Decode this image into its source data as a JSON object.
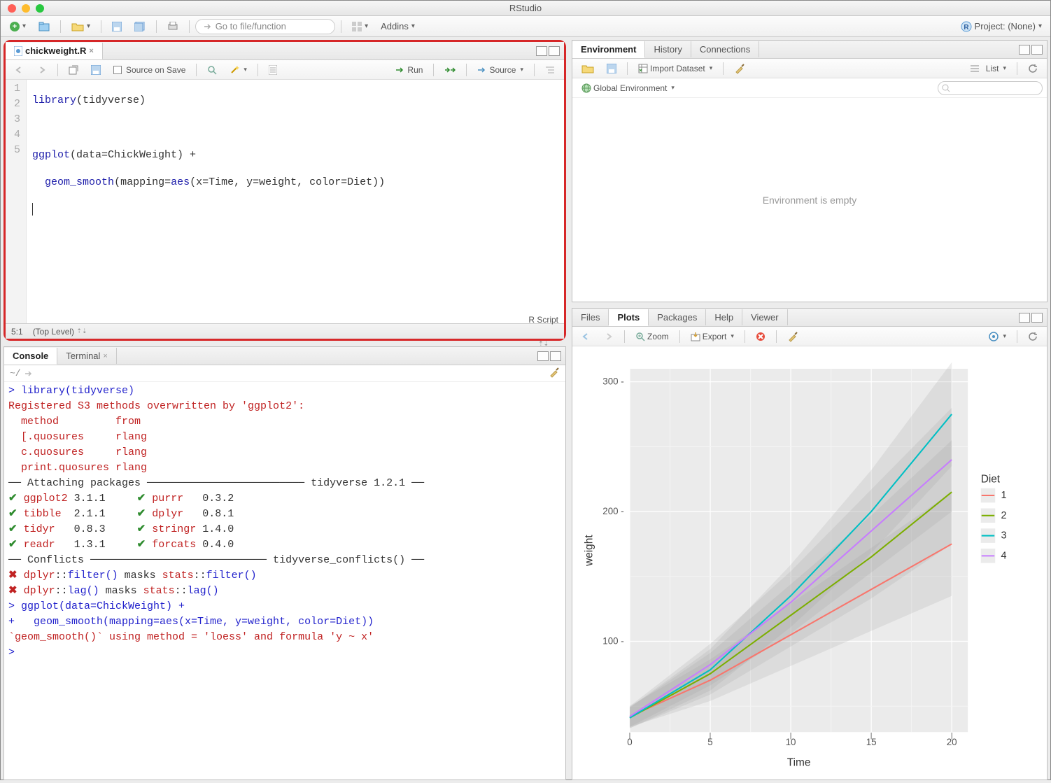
{
  "app": {
    "title": "RStudio"
  },
  "project": {
    "label": "Project: (None)"
  },
  "goto": {
    "placeholder": "Go to file/function"
  },
  "addins": {
    "label": "Addins"
  },
  "source": {
    "tab": "chickweight.R",
    "sourceOnSave": "Source on Save",
    "run": "Run",
    "sourceBtn": "Source",
    "statusPos": "5:1",
    "scope": "(Top Level)",
    "lang": "R Script",
    "lines": {
      "1": "library(tidyverse)",
      "2": "",
      "3": "ggplot(data=ChickWeight) +",
      "4": "  geom_smooth(mapping=aes(x=Time, y=weight, color=Diet))",
      "5": ""
    }
  },
  "console": {
    "tab": "Console",
    "terminal": "Terminal",
    "wd": "~/",
    "lines": [
      {
        "cls": "c-blue",
        "t": "> library(tidyverse)"
      },
      {
        "cls": "c-red",
        "t": "Registered S3 methods overwritten by 'ggplot2':"
      },
      {
        "cls": "c-red",
        "t": "  method         from "
      },
      {
        "cls": "c-red",
        "t": "  [.quosures     rlang"
      },
      {
        "cls": "c-red",
        "t": "  c.quosures     rlang"
      },
      {
        "cls": "c-red",
        "t": "  print.quosures rlang"
      },
      {
        "cls": "c-black",
        "t": "── Attaching packages ───────────────────────── tidyverse 1.2.1 ──"
      },
      {
        "cls": "mix",
        "p": "✔ ggplot2 3.1.1     ✔ purrr   0.3.2"
      },
      {
        "cls": "mix",
        "p": "✔ tibble  2.1.1     ✔ dplyr   0.8.1"
      },
      {
        "cls": "mix",
        "p": "✔ tidyr   0.8.3     ✔ stringr 1.4.0"
      },
      {
        "cls": "mix",
        "p": "✔ readr   1.3.1     ✔ forcats 0.4.0"
      },
      {
        "cls": "c-black",
        "t": "── Conflicts ──────────────────────────── tidyverse_conflicts() ──"
      },
      {
        "cls": "mix2",
        "p": "✖ dplyr::filter() masks stats::filter()"
      },
      {
        "cls": "mix2",
        "p": "✖ dplyr::lag()    masks stats::lag()"
      },
      {
        "cls": "c-blue",
        "t": "> ggplot(data=ChickWeight) +"
      },
      {
        "cls": "c-blue",
        "t": "+   geom_smooth(mapping=aes(x=Time, y=weight, color=Diet))"
      },
      {
        "cls": "c-red",
        "t": "`geom_smooth()` using method = 'loess' and formula 'y ~ x'"
      },
      {
        "cls": "c-blue",
        "t": "> "
      }
    ]
  },
  "env": {
    "tabs": {
      "environment": "Environment",
      "history": "History",
      "connections": "Connections"
    },
    "importDataset": "Import Dataset",
    "listView": "List",
    "scope": "Global Environment",
    "empty": "Environment is empty"
  },
  "plots": {
    "tabs": {
      "files": "Files",
      "plots": "Plots",
      "packages": "Packages",
      "help": "Help",
      "viewer": "Viewer"
    },
    "zoom": "Zoom",
    "export": "Export"
  },
  "chart_data": {
    "type": "line",
    "xlabel": "Time",
    "ylabel": "weight",
    "xlim": [
      0,
      21
    ],
    "ylim": [
      30,
      310
    ],
    "x_ticks": [
      0,
      5,
      10,
      15,
      20
    ],
    "y_ticks": [
      100,
      200,
      300
    ],
    "legend_title": "Diet",
    "series": [
      {
        "name": "1",
        "color": "#F8766D",
        "x": [
          0,
          5,
          10,
          15,
          20
        ],
        "y": [
          42,
          70,
          105,
          140,
          175
        ]
      },
      {
        "name": "2",
        "color": "#7CAE00",
        "x": [
          0,
          5,
          10,
          15,
          20
        ],
        "y": [
          41,
          75,
          120,
          165,
          215
        ]
      },
      {
        "name": "3",
        "color": "#00BFC4",
        "x": [
          0,
          5,
          10,
          15,
          20
        ],
        "y": [
          41,
          78,
          135,
          200,
          275
        ]
      },
      {
        "name": "4",
        "color": "#C77CFF",
        "x": [
          0,
          5,
          10,
          15,
          20
        ],
        "y": [
          42,
          82,
          130,
          185,
          240
        ]
      }
    ]
  }
}
